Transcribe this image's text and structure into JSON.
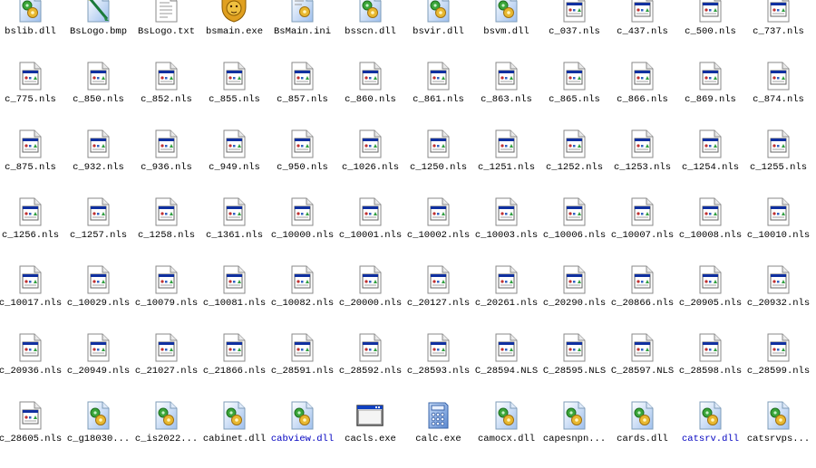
{
  "window": {
    "view": "icons"
  },
  "colors": {
    "compressed_label": "#0000c0",
    "label": "#000000"
  },
  "items": [
    {
      "name": "bslib.dll",
      "icon": "dll"
    },
    {
      "name": "BsLogo.bmp",
      "icon": "bmp"
    },
    {
      "name": "BsLogo.txt",
      "icon": "txt"
    },
    {
      "name": "bsmain.exe",
      "icon": "lion"
    },
    {
      "name": "BsMain.ini",
      "icon": "ini"
    },
    {
      "name": "bsscn.dll",
      "icon": "dll"
    },
    {
      "name": "bsvir.dll",
      "icon": "dll"
    },
    {
      "name": "bsvm.dll",
      "icon": "dll"
    },
    {
      "name": "c_037.nls",
      "icon": "nls"
    },
    {
      "name": "c_437.nls",
      "icon": "nls"
    },
    {
      "name": "c_500.nls",
      "icon": "nls"
    },
    {
      "name": "c_737.nls",
      "icon": "nls"
    },
    {
      "name": "c_775.nls",
      "icon": "nls"
    },
    {
      "name": "c_850.nls",
      "icon": "nls"
    },
    {
      "name": "c_852.nls",
      "icon": "nls"
    },
    {
      "name": "c_855.nls",
      "icon": "nls"
    },
    {
      "name": "c_857.nls",
      "icon": "nls"
    },
    {
      "name": "c_860.nls",
      "icon": "nls"
    },
    {
      "name": "c_861.nls",
      "icon": "nls"
    },
    {
      "name": "c_863.nls",
      "icon": "nls"
    },
    {
      "name": "c_865.nls",
      "icon": "nls"
    },
    {
      "name": "c_866.nls",
      "icon": "nls"
    },
    {
      "name": "c_869.nls",
      "icon": "nls"
    },
    {
      "name": "c_874.nls",
      "icon": "nls"
    },
    {
      "name": "c_875.nls",
      "icon": "nls"
    },
    {
      "name": "c_932.nls",
      "icon": "nls"
    },
    {
      "name": "c_936.nls",
      "icon": "nls"
    },
    {
      "name": "c_949.nls",
      "icon": "nls"
    },
    {
      "name": "c_950.nls",
      "icon": "nls"
    },
    {
      "name": "c_1026.nls",
      "icon": "nls"
    },
    {
      "name": "c_1250.nls",
      "icon": "nls"
    },
    {
      "name": "c_1251.nls",
      "icon": "nls"
    },
    {
      "name": "c_1252.nls",
      "icon": "nls"
    },
    {
      "name": "c_1253.nls",
      "icon": "nls"
    },
    {
      "name": "c_1254.nls",
      "icon": "nls"
    },
    {
      "name": "c_1255.nls",
      "icon": "nls"
    },
    {
      "name": "c_1256.nls",
      "icon": "nls"
    },
    {
      "name": "c_1257.nls",
      "icon": "nls"
    },
    {
      "name": "c_1258.nls",
      "icon": "nls"
    },
    {
      "name": "c_1361.nls",
      "icon": "nls"
    },
    {
      "name": "c_10000.nls",
      "icon": "nls"
    },
    {
      "name": "c_10001.nls",
      "icon": "nls"
    },
    {
      "name": "c_10002.nls",
      "icon": "nls"
    },
    {
      "name": "c_10003.nls",
      "icon": "nls"
    },
    {
      "name": "c_10006.nls",
      "icon": "nls"
    },
    {
      "name": "c_10007.nls",
      "icon": "nls"
    },
    {
      "name": "c_10008.nls",
      "icon": "nls"
    },
    {
      "name": "c_10010.nls",
      "icon": "nls"
    },
    {
      "name": "c_10017.nls",
      "icon": "nls"
    },
    {
      "name": "c_10029.nls",
      "icon": "nls"
    },
    {
      "name": "c_10079.nls",
      "icon": "nls"
    },
    {
      "name": "c_10081.nls",
      "icon": "nls"
    },
    {
      "name": "c_10082.nls",
      "icon": "nls"
    },
    {
      "name": "c_20000.nls",
      "icon": "nls"
    },
    {
      "name": "c_20127.nls",
      "icon": "nls"
    },
    {
      "name": "c_20261.nls",
      "icon": "nls"
    },
    {
      "name": "c_20290.nls",
      "icon": "nls"
    },
    {
      "name": "c_20866.nls",
      "icon": "nls"
    },
    {
      "name": "c_20905.nls",
      "icon": "nls"
    },
    {
      "name": "c_20932.nls",
      "icon": "nls"
    },
    {
      "name": "c_20936.nls",
      "icon": "nls"
    },
    {
      "name": "c_20949.nls",
      "icon": "nls"
    },
    {
      "name": "c_21027.nls",
      "icon": "nls"
    },
    {
      "name": "c_21866.nls",
      "icon": "nls"
    },
    {
      "name": "c_28591.nls",
      "icon": "nls"
    },
    {
      "name": "c_28592.nls",
      "icon": "nls"
    },
    {
      "name": "c_28593.nls",
      "icon": "nls"
    },
    {
      "name": "C_28594.NLS",
      "icon": "nls"
    },
    {
      "name": "C_28595.NLS",
      "icon": "nls"
    },
    {
      "name": "C_28597.NLS",
      "icon": "nls"
    },
    {
      "name": "c_28598.nls",
      "icon": "nls"
    },
    {
      "name": "c_28599.nls",
      "icon": "nls"
    },
    {
      "name": "c_28605.nls",
      "icon": "nls"
    },
    {
      "name": "c_g18030...",
      "icon": "dll"
    },
    {
      "name": "c_is2022...",
      "icon": "dll"
    },
    {
      "name": "cabinet.dll",
      "icon": "dll"
    },
    {
      "name": "cabview.dll",
      "icon": "dll",
      "blue": true
    },
    {
      "name": "cacls.exe",
      "icon": "window"
    },
    {
      "name": "calc.exe",
      "icon": "calc"
    },
    {
      "name": "camocx.dll",
      "icon": "dll"
    },
    {
      "name": "capesnpn...",
      "icon": "dll"
    },
    {
      "name": "cards.dll",
      "icon": "dll"
    },
    {
      "name": "catsrv.dll",
      "icon": "dll",
      "blue": true
    },
    {
      "name": "catsrvps...",
      "icon": "dll"
    }
  ]
}
